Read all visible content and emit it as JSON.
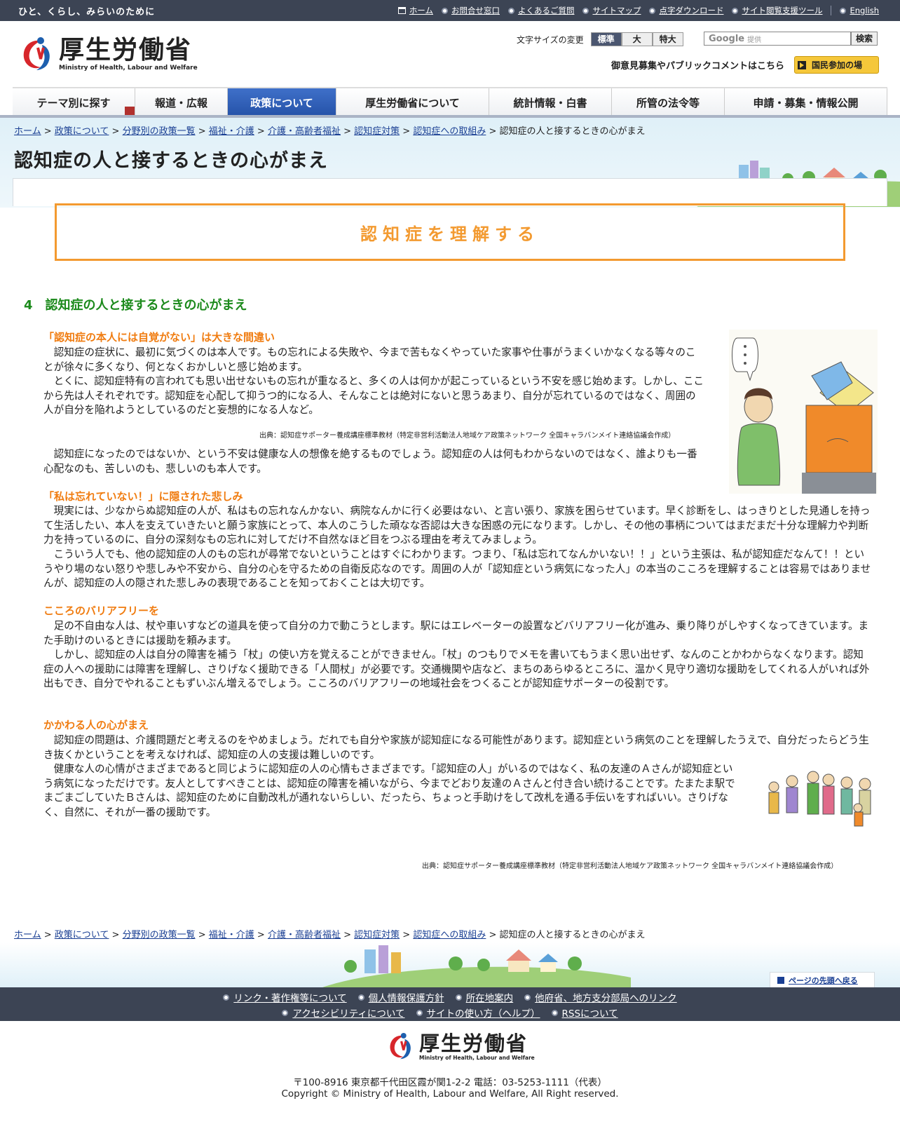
{
  "topbar": {
    "tagline": "ひと、くらし、みらいのために",
    "links": [
      "ホーム",
      "お問合せ窓口",
      "よくあるご質問",
      "サイトマップ",
      "点字ダウンロード",
      "サイト閲覧支援ツール"
    ],
    "english": "English"
  },
  "header": {
    "logo_jp": "厚生労働省",
    "logo_en": "Ministry of Health, Labour and Welfare",
    "fontsize_label": "文字サイズの変更",
    "fontsize_options": [
      "標準",
      "大",
      "特大"
    ],
    "search_brand": "Google",
    "search_placeholder": "提供",
    "search_button": "検索",
    "opinion_text": "御意見募集やパブリックコメントはこちら",
    "kokumin_button": "国民参加の場"
  },
  "nav": [
    "テーマ別に探す",
    "報道・広報",
    "政策について",
    "厚生労働省について",
    "統計情報・白書",
    "所管の法令等",
    "申請・募集・情報公開"
  ],
  "breadcrumb": {
    "links": [
      "ホーム",
      "政策について",
      "分野別の政策一覧",
      "福祉・介護",
      "介護・高齢者福祉",
      "認知症対策",
      "認知症への取組み"
    ],
    "current": "認知症の人と接するときの心がまえ"
  },
  "page_title": "認知症の人と接するときの心がまえ",
  "banner": "認知症を理解する",
  "section_title": "4　認知症の人と接するときの心がまえ",
  "sections": [
    {
      "heading": "「認知症の本人には自覚がない」は大きな間違い",
      "paragraphs": [
        "認知症の症状に、最初に気づくのは本人です。もの忘れによる失敗や、今まで苦もなくやっていた家事や仕事がうまくいかなくなる等々のことが徐々に多くなり、何となくおかしいと感じ始めます。",
        "とくに、認知症特有の言われても思い出せないもの忘れが重なると、多くの人は何かが起こっているという不安を感じ始めます。しかし、ここから先は人それぞれです。認知症を心配して抑うつ的になる人、そんなことは絶対にないと思うあまり、自分が忘れているのではなく、周囲の人が自分を陥れようとしているのだと妄想的になる人など。"
      ],
      "citation": "出典：認知症サポーター養成講座標準教材（特定非営利活動法人地域ケア政策ネットワーク 全国キャラバンメイト連絡協議会作成）",
      "after": "認知症になったのではないか、という不安は健康な人の想像を絶するものでしょう。認知症の人は何もわからないのではなく、誰よりも一番心配なのも、苦しいのも、悲しいのも本人です。"
    },
    {
      "heading": "「私は忘れていない！」に隠された悲しみ",
      "paragraphs": [
        "現実には、少なからぬ認知症の人が、私はもの忘れなんかない、病院なんかに行く必要はない、と言い張り、家族を困らせています。早く診断をし、はっきりとした見通しを持って生活したい、本人を支えていきたいと願う家族にとって、本人のこうした頑なな否認は大きな困惑の元になります。しかし、その他の事柄についてはまだまだ十分な理解力や判断力を持っているのに、自分の深刻なもの忘れに対してだけ不自然なほど目をつぶる理由を考えてみましょう。",
        "こういう人でも、他の認知症の人のもの忘れが尋常でないということはすぐにわかります。つまり、「私は忘れてなんかいない！！」という主張は、私が認知症だなんて！！というやり場のない怒りや悲しみや不安から、自分の心を守るための自衛反応なのです。周囲の人が「認知症という病気になった人」の本当のこころを理解することは容易ではありませんが、認知症の人の隠された悲しみの表現であることを知っておくことは大切です。"
      ]
    },
    {
      "heading": "こころのバリアフリーを",
      "paragraphs": [
        "足の不自由な人は、杖や車いすなどの道具を使って自分の力で動こうとします。駅にはエレベーターの設置などバリアフリー化が進み、乗り降りがしやすくなってきています。また手助けのいるときには援助を頼みます。",
        "しかし、認知症の人は自分の障害を補う「杖」の使い方を覚えることができません。「杖」のつもりでメモを書いてもうまく思い出せず、なんのことかわからなくなります。認知症の人への援助には障害を理解し、さりげなく援助できる「人間杖」が必要です。交通機関や店など、まちのあらゆるところに、温かく見守り適切な援助をしてくれる人がいれば外出もでき、自分でやれることもずいぶん増えるでしょう。こころのバリアフリーの地域社会をつくることが認知症サポーターの役割です。"
      ]
    },
    {
      "heading": "かかわる人の心がまえ",
      "paragraphs": [
        "認知症の問題は、介護問題だと考えるのをやめましょう。だれでも自分や家族が認知症になる可能性があります。認知症という病気のことを理解したうえで、自分だったらどう生き抜くかということを考えなければ、認知症の人の支援は難しいのです。",
        "健康な人の心情がさまざまであると同じように認知症の人の心情もさまざまです。「認知症の人」がいるのではなく、私の友達のＡさんが認知症という病気になっただけです。友人としてすべきことは、認知症の障害を補いながら、今までどおり友達のＡさんと付き合い続けることです。たまたま駅でまごまごしていたＢさんは、認知症のために自動改札が通れないらしい、だったら、ちょっと手助けをして改札を通る手伝いをすればいい。さりげなく、自然に、それが一番の援助です。"
      ],
      "citation": "出典：認知症サポーター養成講座標準教材（特定非営利活動法人地域ケア政策ネットワーク 全国キャラバンメイト連絡協議会作成）"
    }
  ],
  "footer": {
    "pagetop": "ページの先頭へ戻る",
    "links_row1": [
      "リンク・著作権等について",
      "個人情報保護方針",
      "所在地案内",
      "他府省、地方支分部局へのリンク"
    ],
    "links_row2": [
      "アクセシビリティについて",
      "サイトの使い方（ヘルプ）",
      "RSSについて"
    ],
    "address": "〒100-8916 東京都千代田区霞が関1-2-2 電話：03-5253-1111（代表）",
    "copyright": "Copyright © Ministry of Health, Labour and Welfare, All Right reserved."
  },
  "colors": {
    "topbar": "#3c4454",
    "accent_orange": "#f39a30",
    "heading_green": "#1c8a1c",
    "heading_orange": "#f07c10",
    "link": "#1a3f93"
  }
}
